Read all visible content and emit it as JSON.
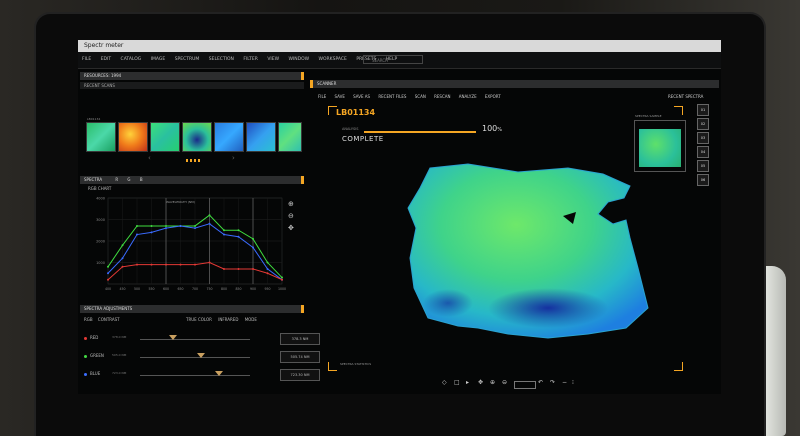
{
  "app": {
    "title": "Spectr meter",
    "menu": [
      "FILE",
      "EDIT",
      "CATALOG",
      "IMAGE",
      "SPECTRUM",
      "SELECTION",
      "FILTER",
      "VIEW",
      "WINDOW",
      "WORKSPACE",
      "PRESETS",
      "HELP"
    ],
    "search_placeholder": "SEARCH"
  },
  "left": {
    "resources_header": "RESOURCES: 1994",
    "recent_header": "RECENT SCANS",
    "thumb_labels": [
      "LB01134",
      "",
      "",
      "",
      "",
      ""
    ],
    "spectra_header": "SPECTRA",
    "spectra_tabs": [
      "R",
      "G",
      "B"
    ],
    "chart_title": "RGB CHART",
    "chart_annotation": "WAVELENGTH (NM)",
    "adjust_header": "SPECTRA ADJUSTMENTS",
    "adjust_tabs_left": [
      "RGB",
      "CONTRAST"
    ],
    "adjust_tabs_right": [
      "TRUE COLOR",
      "INFRARED",
      "MODE"
    ],
    "sliders": [
      {
        "name": "RED",
        "range_lo": "378.0 NM",
        "value": "378.3 NM",
        "level": 0.3,
        "color": "#e53935"
      },
      {
        "name": "GREEN",
        "range_lo": "505.0 NM",
        "value": "505.74 NM",
        "level": 0.55,
        "color": "#43d843"
      },
      {
        "name": "BLUE",
        "range_lo": "723.0 NM",
        "value": "723.30 NM",
        "level": 0.72,
        "color": "#3b6dff"
      }
    ]
  },
  "chart_data": {
    "type": "line",
    "title": "RGB CHART",
    "x": [
      "400",
      "450",
      "500",
      "550",
      "600",
      "650",
      "700",
      "750",
      "800",
      "850",
      "900",
      "950",
      "1000"
    ],
    "ylim": [
      0,
      4000
    ],
    "y_ticks": [
      "4000",
      "3000",
      "2000",
      "1000"
    ],
    "series": [
      {
        "name": "GREEN",
        "color": "#3fdc3f",
        "values": [
          800,
          1800,
          2700,
          2700,
          2700,
          2700,
          2700,
          3200,
          2500,
          2500,
          2100,
          1000,
          300
        ]
      },
      {
        "name": "BLUE",
        "color": "#3a6bff",
        "values": [
          500,
          1200,
          2300,
          2400,
          2600,
          2700,
          2600,
          2800,
          2300,
          2200,
          1700,
          700,
          200
        ]
      },
      {
        "name": "RED",
        "color": "#e53935",
        "values": [
          200,
          800,
          900,
          900,
          900,
          900,
          900,
          1000,
          700,
          700,
          700,
          500,
          200
        ]
      }
    ]
  },
  "right": {
    "header": "SCANNER",
    "doc_menu": [
      "FILE",
      "SAVE",
      "SAVE AS",
      "RECENT FILES",
      "SCAN",
      "RESCAN",
      "ANALYZE",
      "EXPORT"
    ],
    "recent_label": "RECENT SPECTRA",
    "scan_id": "LB01134",
    "progress_label": "ANALYSIS",
    "progress_pct": "100",
    "progress_unit": "%",
    "progress": 1.0,
    "status": "COMPLETE",
    "preview_label": "SPECTRA SAMPLE",
    "side_buttons": [
      "01",
      "02",
      "03",
      "04",
      "05",
      "06"
    ],
    "footer_label": "SPECTRA STATISTICS"
  },
  "colors": {
    "accent": "#f5a623",
    "panel": "#2c2d2e",
    "screen": "#050606"
  }
}
